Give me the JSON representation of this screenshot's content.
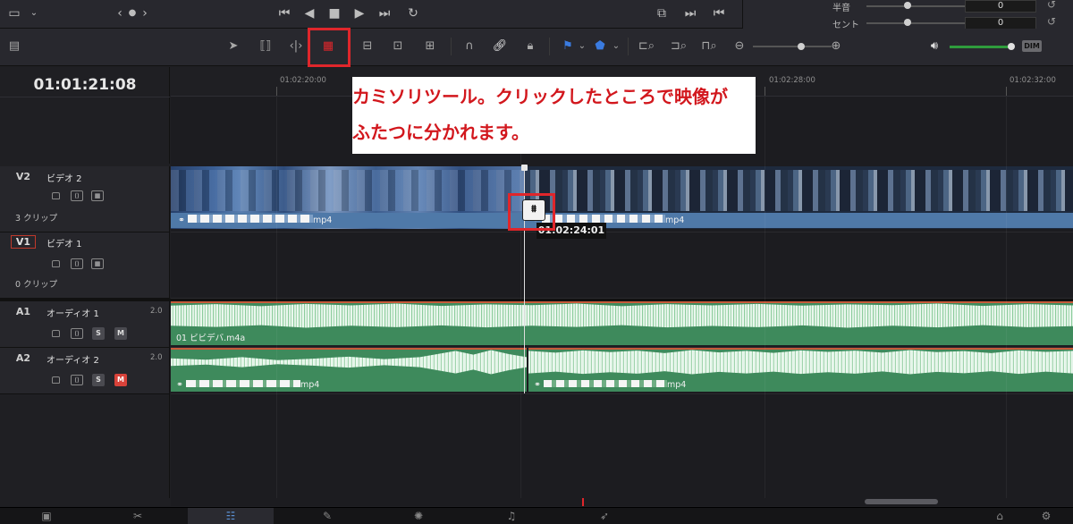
{
  "timecode": "01:01:21:08",
  "ruler": {
    "ticks": [
      "01:02:20:00",
      "01:02:28:00",
      "01:02:32:00"
    ]
  },
  "mixer": {
    "rows": [
      {
        "label": "半音",
        "value": "0"
      },
      {
        "label": "セント",
        "value": "0"
      }
    ]
  },
  "toolbar": {
    "dim_label": "DIM"
  },
  "annotation": {
    "callout_line1": "カミソリツール。クリックしたところで映像が",
    "callout_line2": "ふたつに分かれます。",
    "razor_timecode": "01:02:24:01"
  },
  "tracks": {
    "v2": {
      "id": "V2",
      "name": "ビデオ 2",
      "clip_count": "3 クリップ",
      "clip1_label": "mp4",
      "clip2_label": "mp4"
    },
    "v1": {
      "id": "V1",
      "name": "ビデオ 1",
      "clip_count": "0 クリップ"
    },
    "a1": {
      "id": "A1",
      "name": "オーディオ 1",
      "channels": "2.0",
      "clip_label": "01 ビビデバ.m4a",
      "solo": "S",
      "mute": "M"
    },
    "a2": {
      "id": "A2",
      "name": "オーディオ 2",
      "channels": "2.0",
      "clip1_label": "mp4",
      "clip2_label": "mp4",
      "solo": "S",
      "mute": "M"
    }
  },
  "colors": {
    "accent_red": "#e0262b",
    "video_clip": "#4f79a8",
    "audio_clip": "#3e8a5c"
  }
}
